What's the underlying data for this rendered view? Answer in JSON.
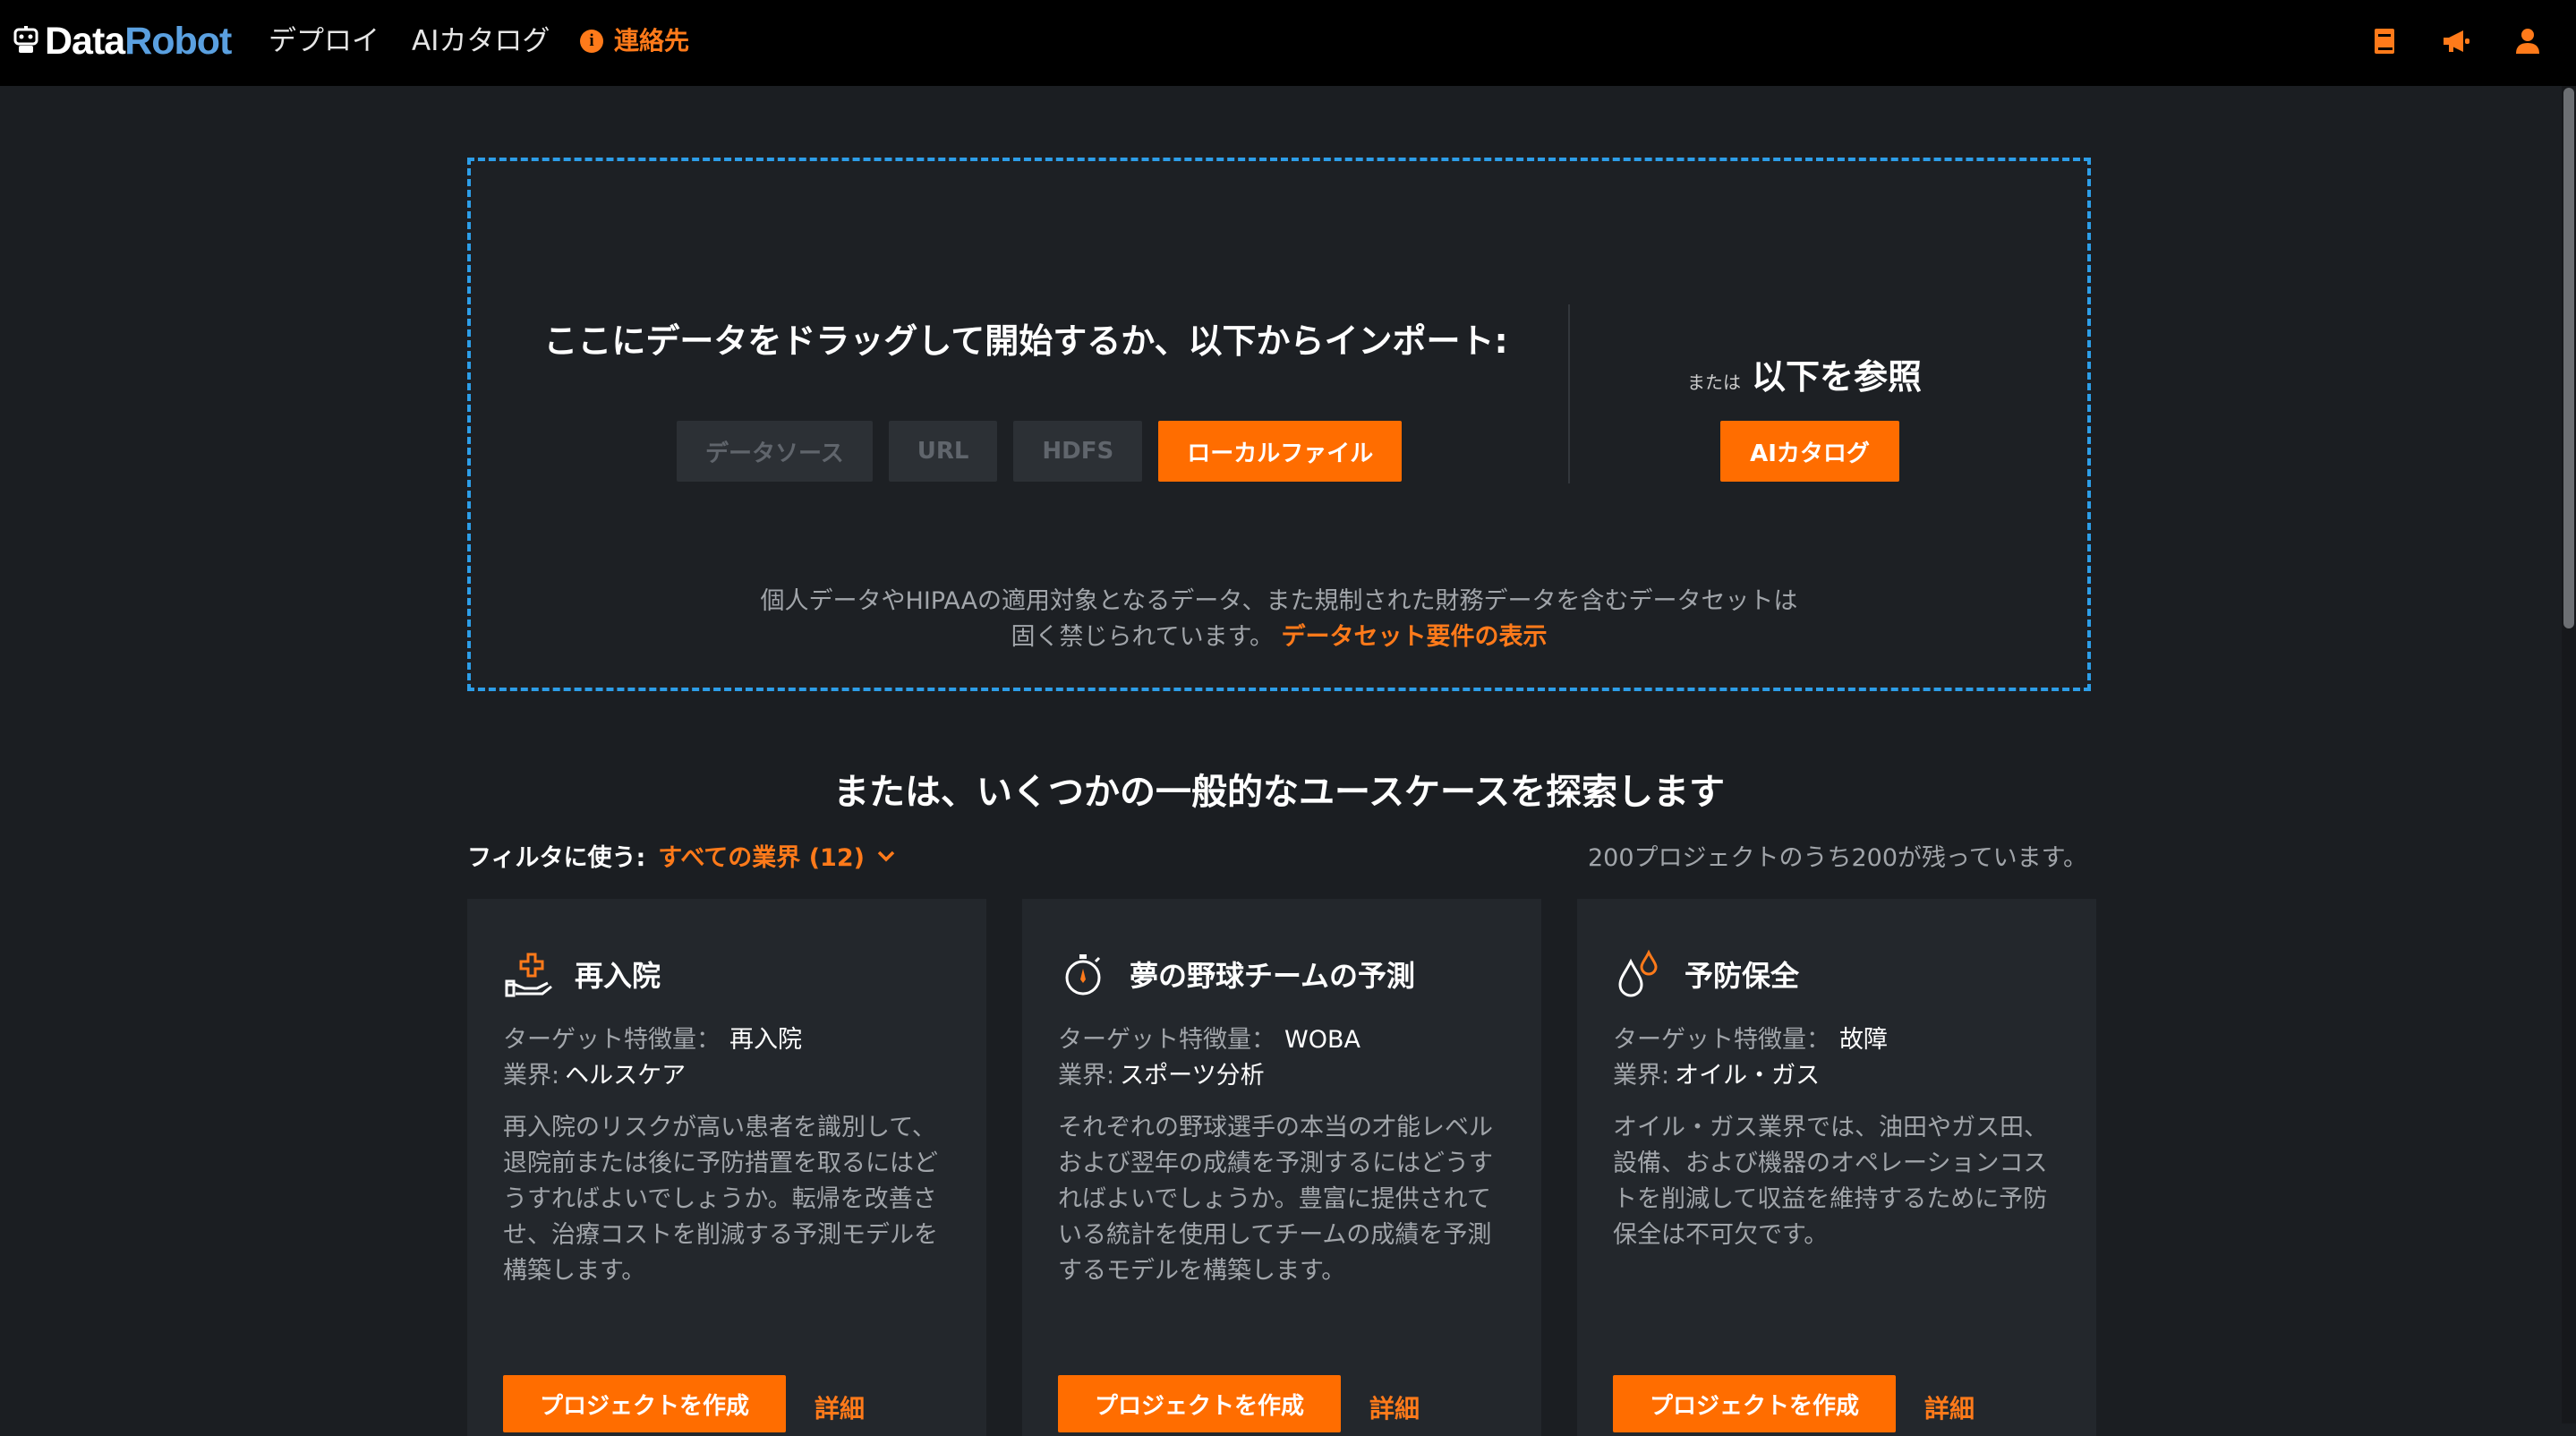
{
  "header": {
    "brand_part1": "Data",
    "brand_part2": "Robot",
    "nav": [
      "デプロイ",
      "AIカタログ"
    ],
    "contact_label": "連絡先",
    "right_icons": [
      "book-icon",
      "megaphone-icon",
      "user-icon"
    ],
    "accent_color": "#ff7a1a"
  },
  "dropzone": {
    "title": "ここにデータをドラッグして開始するか、以下からインポート:",
    "sources": [
      {
        "label": "データソース",
        "enabled": false
      },
      {
        "label": "URL",
        "enabled": false
      },
      {
        "label": "HDFS",
        "enabled": false
      },
      {
        "label": "ローカルファイル",
        "enabled": true
      }
    ],
    "or_small": "または",
    "or_big": "以下を参照",
    "catalog_button": "AIカタログ",
    "note_line1": "個人データやHIPAAの適用対象となるデータ、また規制された財務データを含むデータセットは",
    "note_line2": "固く禁じられています。",
    "note_link": "データセット要件の表示",
    "border_color": "#2d9ee8"
  },
  "usecases": {
    "title": "または、いくつかの一般的なユースケースを探索します",
    "filter_label": "フィルタに使う:",
    "filter_value": "すべての業界 (12)",
    "count_text": "200プロジェクトのうち200が残っています。",
    "target_label": "ターゲット特徴量：",
    "industry_label": "業界:",
    "create_button": "プロジェクトを作成",
    "details_link": "詳細",
    "cards": [
      {
        "title": "再入院",
        "icon": "hand-medical-icon",
        "target": "再入院",
        "industry": "ヘルスケア",
        "desc": "再入院のリスクが高い患者を識別して、退院前または後に予防措置を取るにはどうすればよいでしょうか。転帰を改善させ、治療コストを削減する予測モデルを構築します。"
      },
      {
        "title": "夢の野球チームの予測",
        "icon": "stopwatch-icon",
        "target": "WOBA",
        "industry": "スポーツ分析",
        "desc": "それぞれの野球選手の本当の才能レベルおよび翌年の成績を予測するにはどうすればよいでしょうか。豊富に提供されている統計を使用してチームの成績を予測するモデルを構築します。"
      },
      {
        "title": "予防保全",
        "icon": "oil-drops-icon",
        "target": "故障",
        "industry": "オイル・ガス",
        "desc": "オイル・ガス業界では、油田やガス田、設備、および機器のオペレーションコストを削減して収益を維持するために予防保全は不可欠です。"
      }
    ]
  }
}
